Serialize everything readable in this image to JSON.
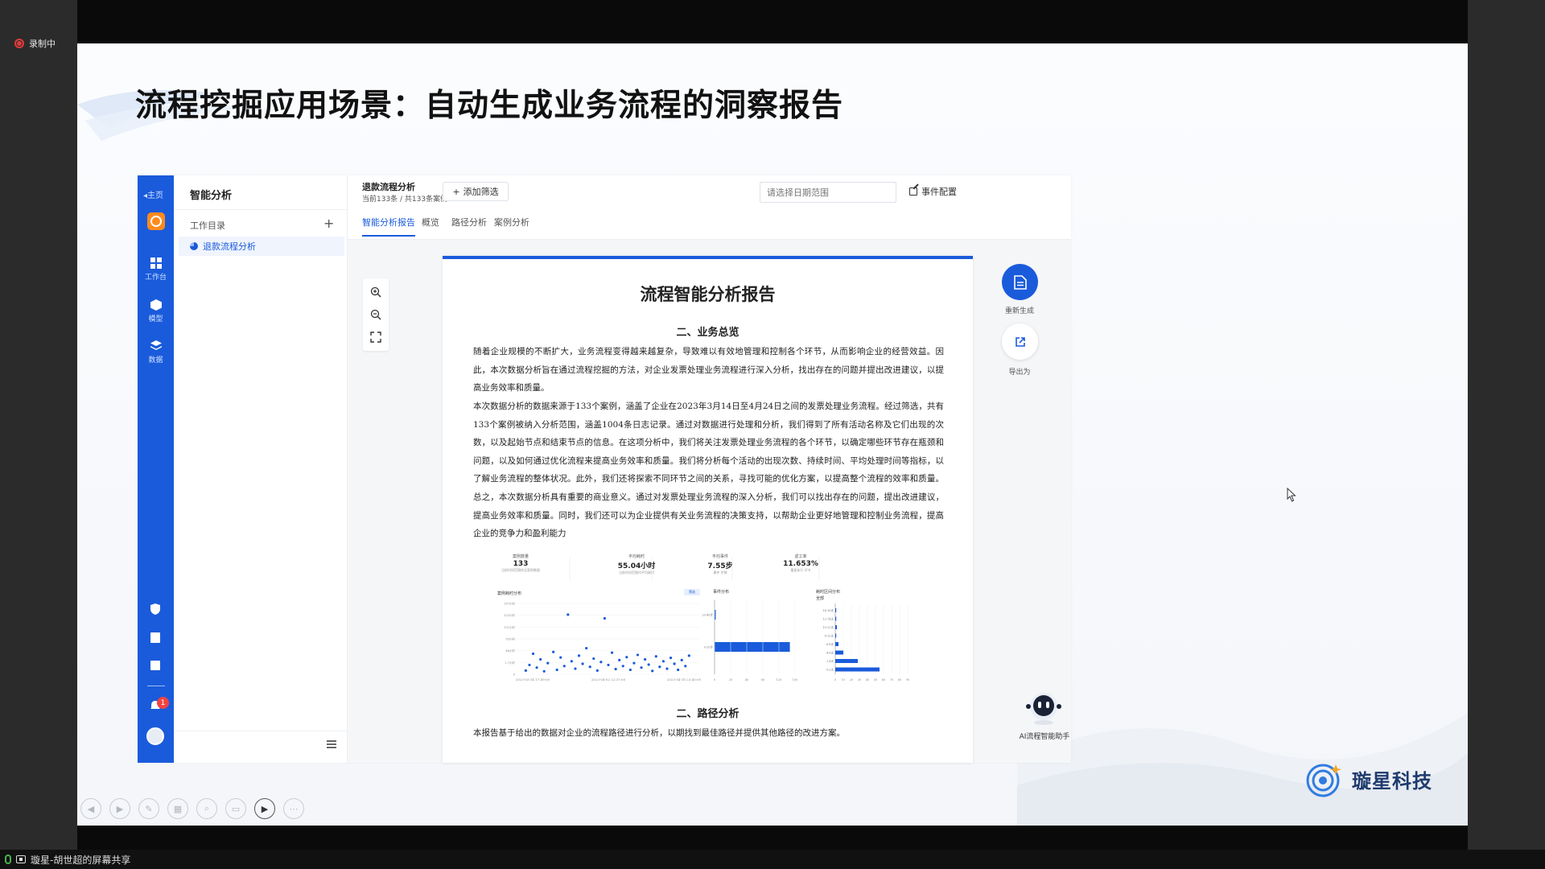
{
  "recording": {
    "label": "录制中"
  },
  "status_bar": {
    "text": "璇星-胡世超的屏幕共享"
  },
  "slide": {
    "title": "流程挖掘应用场景：自动生成业务流程的洞察报告"
  },
  "brand": {
    "name": "璇星科技"
  },
  "rail": {
    "back_label": "◂主页",
    "items": [
      {
        "label": "工作台",
        "icon": "dashboard-icon"
      },
      {
        "label": "模型",
        "icon": "cube-icon"
      },
      {
        "label": "数据",
        "icon": "layers-icon"
      }
    ],
    "notification_count": "1"
  },
  "panel": {
    "title": "智能分析",
    "directory_label": "工作目录",
    "add_label": "+",
    "active_item": "退款流程分析"
  },
  "header": {
    "title": "退款流程分析",
    "subtitle": "当前133条 / 共133条案例",
    "add_filter_label": "添加筛选",
    "date_placeholder": "请选择日期范围",
    "event_config_label": "事件配置"
  },
  "tabs": [
    {
      "label": "智能分析报告",
      "active": true
    },
    {
      "label": "概览",
      "active": false
    },
    {
      "label": "路径分析",
      "active": false
    },
    {
      "label": "案例分析",
      "active": false
    }
  ],
  "report": {
    "title": "流程智能分析报告",
    "section1_title": "二、业务总览",
    "para1": "随着企业规模的不断扩大，业务流程变得越来越复杂，导致难以有效地管理和控制各个环节，从而影响企业的经营效益。因此，本次数据分析旨在通过流程挖掘的方法，对企业发票处理业务流程进行深入分析，找出存在的问题并提出改进建议，以提高业务效率和质量。",
    "para2": "本次数据分析的数据来源于133个案例，涵盖了企业在2023年3月14日至4月24日之间的发票处理业务流程。经过筛选，共有133个案例被纳入分析范围，涵盖1004条日志记录。通过对数据进行处理和分析，我们得到了所有活动名称及它们出现的次数，以及起始节点和结束节点的信息。在这项分析中，我们将关注发票处理业务流程的各个环节，以确定哪些环节存在瓶颈和问题，以及如何通过优化流程来提高业务效率和质量。我们将分析每个活动的出现次数、持续时间、平均处理时间等指标，以了解业务流程的整体状况。此外，我们还将探索不同环节之间的关系，寻找可能的优化方案，以提高整个流程的效率和质量。总之，本次数据分析具有重要的商业意义。通过对发票处理业务流程的深入分析，我们可以找出存在的问题，提出改进建议，提高业务效率和质量。同时，我们还可以为企业提供有关业务流程的决策支持，以帮助企业更好地管理和控制业务流程，提高企业的竞争力和盈利能力",
    "section2_title": "二、路径分析",
    "para3": "本报告基于给出的数据对企业的流程路径进行分析，以期找到最佳路径并提供其他路径的改进方案。"
  },
  "dashboard": {
    "kpis": [
      {
        "label": "案例数量",
        "value": "133",
        "note": "当前时间范围的总案例数量"
      },
      {
        "label": "平均耗时",
        "value": "55.04小时",
        "note": "当前时间范围内平均耗时"
      },
      {
        "label": "平均事件",
        "value": "7.55步",
        "note": "事件 步数"
      },
      {
        "label": "返工率",
        "value": "11.653%",
        "note": "重复执行 环节"
      }
    ],
    "scatter_title": "案例耗时分布",
    "scatter_button": "筛选",
    "events_title": "事件分布",
    "duration_title": "耗时区间分布",
    "duration_sub": "全部"
  },
  "chart_data": [
    {
      "type": "scatter",
      "title": "案例耗时分布",
      "xlabel": "",
      "ylabel": "",
      "x_ticks": [
        "2023-03-14 17:49:00",
        "2023-04-02 22:37:00",
        "2023-04-18 23:45:00"
      ],
      "y_ticks": [
        "0",
        "2.7小时",
        "48小时",
        "85小时",
        "121小时",
        "153小时",
        "187小时"
      ],
      "series": [
        {
          "points": [
            [
              0.05,
              10
            ],
            [
              0.07,
              25
            ],
            [
              0.09,
              55
            ],
            [
              0.11,
              18
            ],
            [
              0.13,
              40
            ],
            [
              0.15,
              8
            ],
            [
              0.17,
              30
            ],
            [
              0.2,
              60
            ],
            [
              0.22,
              12
            ],
            [
              0.24,
              45
            ],
            [
              0.26,
              22
            ],
            [
              0.28,
              160
            ],
            [
              0.3,
              35
            ],
            [
              0.32,
              15
            ],
            [
              0.34,
              50
            ],
            [
              0.36,
              28
            ],
            [
              0.38,
              70
            ],
            [
              0.4,
              20
            ],
            [
              0.42,
              42
            ],
            [
              0.44,
              10
            ],
            [
              0.46,
              33
            ],
            [
              0.48,
              150
            ],
            [
              0.5,
              25
            ],
            [
              0.52,
              58
            ],
            [
              0.54,
              14
            ],
            [
              0.56,
              38
            ],
            [
              0.58,
              22
            ],
            [
              0.6,
              46
            ],
            [
              0.62,
              12
            ],
            [
              0.64,
              30
            ],
            [
              0.66,
              52
            ],
            [
              0.68,
              18
            ],
            [
              0.7,
              40
            ],
            [
              0.72,
              26
            ],
            [
              0.74,
              9
            ],
            [
              0.76,
              48
            ],
            [
              0.78,
              20
            ],
            [
              0.8,
              35
            ],
            [
              0.82,
              15
            ],
            [
              0.84,
              44
            ],
            [
              0.86,
              28
            ],
            [
              0.88,
              12
            ],
            [
              0.9,
              38
            ],
            [
              0.92,
              22
            ],
            [
              0.94,
              50
            ]
          ]
        }
      ]
    },
    {
      "type": "bar",
      "title": "事件分布",
      "categories": [
        "20-40步",
        "0-20步"
      ],
      "values": [
        2,
        131
      ],
      "x_ticks": [
        "0",
        "20",
        "40",
        "60",
        "120",
        "100"
      ]
    },
    {
      "type": "bar",
      "title": "耗时区间分布",
      "categories": [
        "14-16天",
        "12-14天",
        "10-12天",
        "8-10天",
        "6-8天",
        "4-6天",
        "2-4天",
        "0-2天"
      ],
      "values": [
        1,
        1,
        2,
        1,
        4,
        10,
        28,
        55
      ],
      "x_ticks": [
        "0",
        "10",
        "20",
        "30",
        "40",
        "50",
        "60",
        "70",
        "80",
        "90"
      ]
    }
  ],
  "actions": {
    "regenerate_label": "重新生成",
    "export_label": "导出为",
    "assistant_label": "AI流程智能助手"
  },
  "colors": {
    "primary": "#1a5bdb",
    "accent_orange": "#ff8a1c",
    "badge_red": "#f04444"
  }
}
